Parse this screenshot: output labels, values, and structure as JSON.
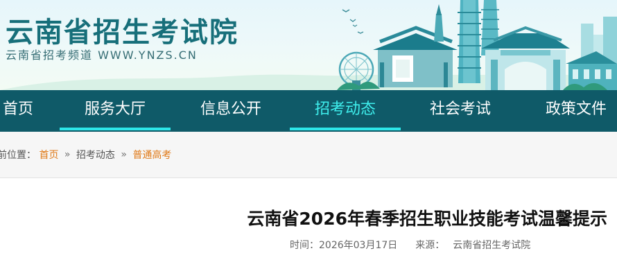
{
  "header": {
    "title": "云南省招生考试院",
    "subtitle": "云南省招考频道 WWW.YNZS.CN"
  },
  "nav": {
    "items": [
      {
        "label": "首页"
      },
      {
        "label": "服务大厅"
      },
      {
        "label": "信息公开"
      },
      {
        "label": "招考动态"
      },
      {
        "label": "社会考试"
      },
      {
        "label": "政策文件"
      }
    ],
    "active": "招考动态"
  },
  "breadcrumb": {
    "prefix": "前位置：",
    "items": [
      "首页",
      "招考动态",
      "普通高考"
    ],
    "separator": "»"
  },
  "article": {
    "title": "云南省2026年春季招生职业技能考试温馨提示",
    "time_label": "时间：",
    "time_value": "2026年03月17日",
    "source_label": "来源：",
    "source_value": "云南省招生考试院"
  },
  "colors": {
    "nav_bg": "#0f5a68",
    "nav_active": "#3ff0ee",
    "underline": "#2de6e8",
    "title_teal": "#176f7a",
    "crumb_link": "#e07a19"
  }
}
